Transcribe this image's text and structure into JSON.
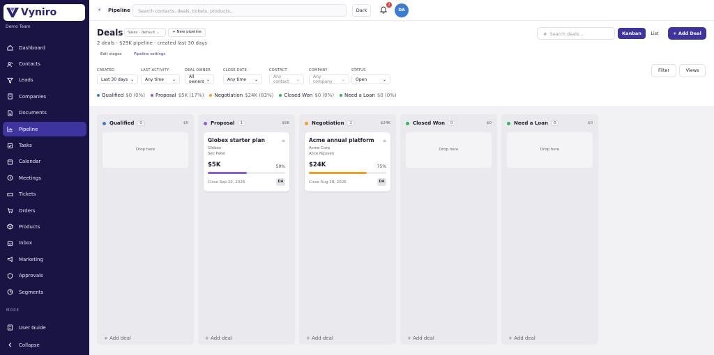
{
  "app": {
    "brand": "Vyniro",
    "team": "Demo Team"
  },
  "sidebar": {
    "items": [
      {
        "label": "Dashboard",
        "icon": "home-icon"
      },
      {
        "label": "Contacts",
        "icon": "contacts-icon"
      },
      {
        "label": "Leads",
        "icon": "funnel-icon"
      },
      {
        "label": "Companies",
        "icon": "building-icon"
      },
      {
        "label": "Documents",
        "icon": "document-icon"
      },
      {
        "label": "Pipeline",
        "icon": "chart-icon"
      },
      {
        "label": "Tasks",
        "icon": "checkbox-icon"
      },
      {
        "label": "Calendar",
        "icon": "calendar-icon"
      },
      {
        "label": "Meetings",
        "icon": "clock-icon"
      },
      {
        "label": "Tickets",
        "icon": "ticket-icon"
      },
      {
        "label": "Orders",
        "icon": "cart-icon"
      },
      {
        "label": "Products",
        "icon": "box-icon"
      },
      {
        "label": "Inbox",
        "icon": "inbox-icon"
      },
      {
        "label": "Marketing",
        "icon": "megaphone-icon"
      },
      {
        "label": "Approvals",
        "icon": "shield-icon"
      },
      {
        "label": "Segments",
        "icon": "pie-icon"
      }
    ],
    "active": "Pipeline",
    "more_label": "MORE",
    "user_guide": "User Guide",
    "collapse": "Collapse"
  },
  "topbar": {
    "title": "Pipeline",
    "search_placeholder": "Search contacts, deals, tickets, products...",
    "theme_button": "Dark",
    "notification_count": "2",
    "avatar": "DA"
  },
  "header": {
    "title": "Deals",
    "pipeline_select": "Sales · default",
    "new_pipeline": "+ New pipeline",
    "subtitle": "2 deals · $29K pipeline · created last 30 days",
    "edit_stages": "Edit stages",
    "pipeline_settings": "Pipeline settings",
    "search_deals": "Search deals...",
    "view_kanban": "Kanban",
    "view_list": "List",
    "add_deal": "+ Add Deal"
  },
  "filters": [
    {
      "label": "CREATED",
      "value": "Last 30 days"
    },
    {
      "label": "LAST ACTIVITY",
      "value": "Any time"
    },
    {
      "label": "DEAL OWNER",
      "value": "All owners"
    },
    {
      "label": "CLOSE DATE",
      "value": "Any time"
    },
    {
      "label": "CONTACT",
      "value": "Any contact"
    },
    {
      "label": "COMPANY",
      "value": "Any company"
    },
    {
      "label": "STATUS",
      "value": "Open"
    }
  ],
  "filter_button": "Filter",
  "views_button": "Views",
  "summary": [
    {
      "name": "Qualified",
      "value": "$0 (0%)",
      "color": "#3a7bd5"
    },
    {
      "name": "Proposal",
      "value": "$5K (17%)",
      "color": "#8a5cd6"
    },
    {
      "name": "Negotiation",
      "value": "$24K (83%)",
      "color": "#f0a020"
    },
    {
      "name": "Closed Won",
      "value": "$0 (0%)",
      "color": "#2eb85c"
    },
    {
      "name": "Need a Loan",
      "value": "$0 (0%)",
      "color": "#2eb85c"
    }
  ],
  "columns": [
    {
      "name": "Qualified",
      "count": "0",
      "total": "$0",
      "color": "#3a7bd5",
      "drop": "Drop here",
      "add": "+ Add deal"
    },
    {
      "name": "Proposal",
      "count": "1",
      "total": "$5K",
      "color": "#8a5cd6",
      "add": "+ Add deal",
      "card": {
        "title": "Globex starter plan",
        "company": "Globex",
        "contact": "Sec Patel",
        "amount": "$5K",
        "pct_label": "50%",
        "progress": 0.5,
        "close": "Close Sep 22, 2026",
        "owner": "DA"
      }
    },
    {
      "name": "Negotiation",
      "count": "1",
      "total": "$24K",
      "color": "#f0a020",
      "add": "+ Add deal",
      "card": {
        "title": "Acme annual platform",
        "company": "Acme Corp",
        "contact": "Alice Nguyen",
        "amount": "$24K",
        "pct_label": "75%",
        "progress": 0.75,
        "close": "Close Aug 28, 2026",
        "owner": "DA"
      }
    },
    {
      "name": "Closed Won",
      "count": "0",
      "total": "$0",
      "color": "#2eb85c",
      "drop": "Drop here",
      "add": "+ Add deal"
    },
    {
      "name": "Need a Loan",
      "count": "0",
      "total": "$0",
      "color": "#2eb85c",
      "drop": "Drop here",
      "add": "+ Add deal"
    }
  ]
}
